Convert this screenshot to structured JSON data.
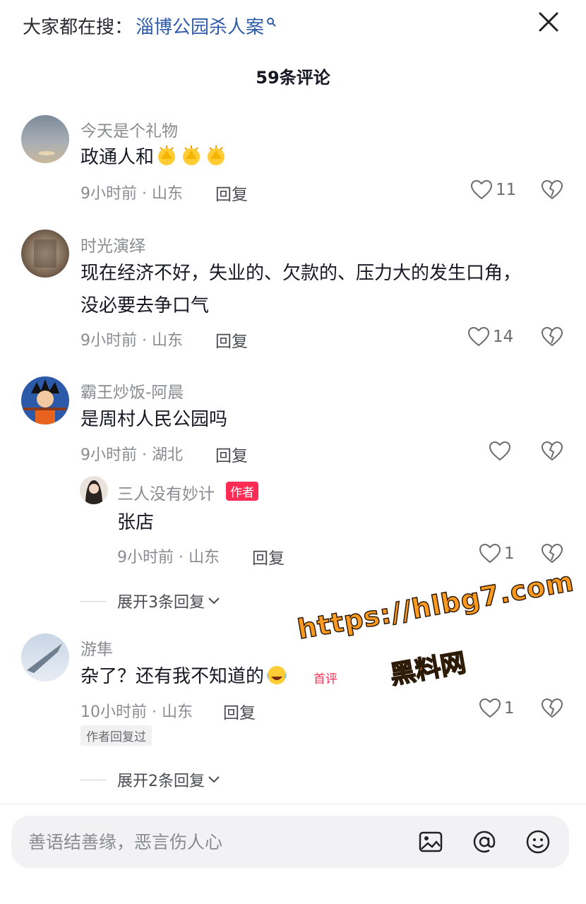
{
  "header": {
    "hot_prefix": "大家都在搜：",
    "hot_term": "淄博公园杀人案",
    "count_label": "59条评论"
  },
  "comments": [
    {
      "name": "今天是个礼物",
      "text": "政通人和",
      "emoji": [
        "clap-emoji",
        "clap-emoji",
        "clap-emoji"
      ],
      "time_loc": "9小时前 · 山东",
      "reply": "回复",
      "likes": "11"
    },
    {
      "name": "时光演绎",
      "text_line1": "现在经济不好，失业的、欠款的、压力大的发生口角，",
      "text_line2": "没必要去争口气",
      "time_loc": "9小时前 · 山东",
      "reply": "回复",
      "likes": "14"
    },
    {
      "name": "霸王炒饭-阿晨",
      "text": "是周村人民公园吗",
      "time_loc": "9小时前 · 湖北",
      "reply": "回复",
      "likes": "",
      "sub_reply": {
        "name": "三人没有妙计",
        "author_tag": "作者",
        "text": "张店",
        "time_loc": "9小时前 · 山东",
        "reply": "回复",
        "likes": "1"
      },
      "expand": "展开3条回复"
    },
    {
      "name": "游隼",
      "text": "杂了？还有我不知道的",
      "emoji": [
        "laugh-cry-emoji"
      ],
      "first_tag": "首评",
      "time_loc": "10小时前 · 山东",
      "reply": "回复",
      "likes": "1",
      "badge": "作者回复过",
      "expand": "展开2条回复"
    }
  ],
  "watermark": {
    "line1": "https://hlbg7.com",
    "line2": "黑料网"
  },
  "input": {
    "placeholder": "善语结善缘，恶言伤人心",
    "icons": [
      "image-icon",
      "at-icon",
      "emoji-icon"
    ]
  },
  "colors": {
    "accent_red": "#fe2c55",
    "link_blue": "#2f5aa8",
    "watermark_orange": "#ff9a1f"
  }
}
